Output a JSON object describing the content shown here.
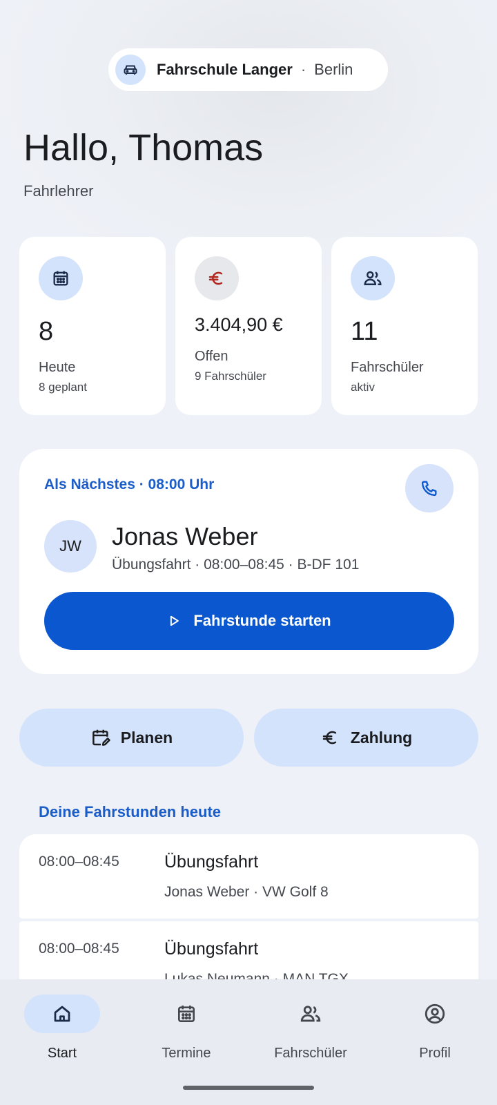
{
  "header": {
    "school_name": "Fahrschule Langer",
    "separator": "·",
    "city": "Berlin",
    "icon": "car-icon"
  },
  "greeting": "Hallo, Thomas",
  "role": "Fahrlehrer",
  "stats": [
    {
      "icon": "calendar-icon",
      "value": "8",
      "label": "Heute",
      "sub": "8 geplant",
      "icon_bg": "#d4e3fc",
      "icon_color": "#1b2b4a"
    },
    {
      "icon": "euro-icon",
      "value": "3.404,90 €",
      "label": "Offen",
      "sub": "9 Fahrschüler",
      "icon_bg": "#e7e8eb",
      "icon_color": "#b3261e"
    },
    {
      "icon": "people-icon",
      "value": "11",
      "label": "Fahrschüler",
      "sub": "aktiv",
      "icon_bg": "#d4e3fc",
      "icon_color": "#1b2b4a"
    }
  ],
  "next": {
    "label": "Als Nächstes · 08:00 Uhr",
    "initials": "JW",
    "student": "Jonas Weber",
    "meta": "Übungsfahrt · 08:00–08:45 · B-DF 101",
    "start_label": "Fahrstunde starten"
  },
  "actions": {
    "plan_label": "Planen",
    "payment_label": "Zahlung"
  },
  "today": {
    "title": "Deine Fahrstunden heute",
    "lessons": [
      {
        "time": "08:00–08:45",
        "type": "Übungsfahrt",
        "who": "Jonas Weber · VW Golf 8"
      },
      {
        "time": "08:00–08:45",
        "type": "Übungsfahrt",
        "who": "Lukas Neumann · MAN TGX"
      }
    ]
  },
  "nav": [
    {
      "label": "Start",
      "icon": "home-icon",
      "active": true
    },
    {
      "label": "Termine",
      "icon": "calendar-icon",
      "active": false
    },
    {
      "label": "Fahrschüler",
      "icon": "people-icon",
      "active": false
    },
    {
      "label": "Profil",
      "icon": "profile-icon",
      "active": false
    }
  ],
  "colors": {
    "accent": "#0b57cf",
    "accent_text": "#1a5cc8",
    "tonal": "#d4e3fc",
    "background": "#eef1f7",
    "euro_red": "#b3261e"
  }
}
